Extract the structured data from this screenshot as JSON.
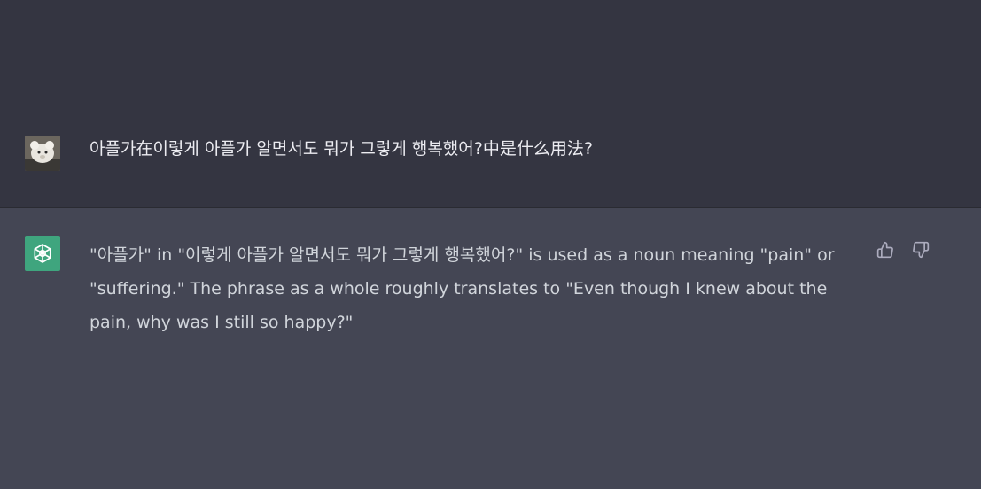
{
  "user_message": {
    "text": "아플가在이렇게 아플가 알면서도 뭐가 그렇게 행복했어?中是什么用法?"
  },
  "assistant_message": {
    "text": "\"아플가\" in \"이렇게 아플가 알면서도 뭐가 그렇게 행복했어?\" is used as a noun meaning \"pain\" or \"suffering.\" The phrase as a whole roughly translates to \"Even though I knew about the pain, why was I still so happy?\""
  },
  "icons": {
    "user_avatar": "user-avatar-photo",
    "assistant_avatar": "openai-logo-icon",
    "thumbs_up": "thumbs-up-icon",
    "thumbs_down": "thumbs-down-icon"
  },
  "colors": {
    "user_bg": "#343541",
    "assistant_bg": "#444654",
    "assistant_avatar_bg": "#3fa57e",
    "text_primary": "#ececf1",
    "text_secondary": "#d1d5db"
  }
}
